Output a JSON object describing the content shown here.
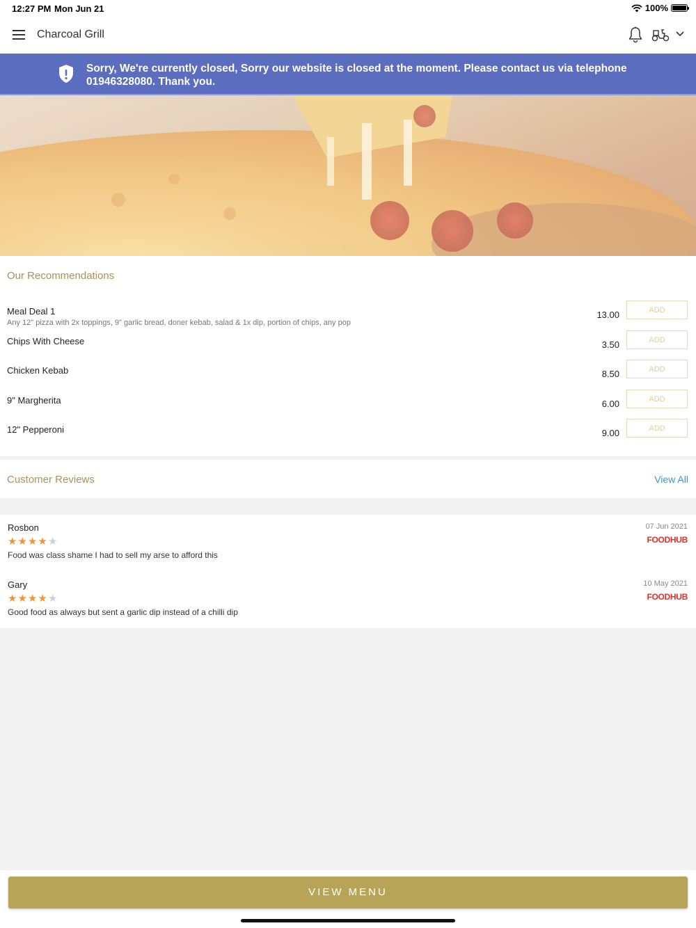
{
  "status_bar": {
    "time": "12:27 PM",
    "date": "Mon Jun 21",
    "battery": "100%"
  },
  "header": {
    "title": "Charcoal Grill"
  },
  "banner": {
    "message": "Sorry, We're currently closed, Sorry our website is closed at the moment. Please contact us via telephone 01946328080. Thank you."
  },
  "recommendations": {
    "title": "Our Recommendations",
    "items": [
      {
        "name": "Meal Deal 1",
        "description": "Any 12\" pizza with 2x toppings, 9\" garlic bread, doner kebab, salad & 1x dip, portion of chips, any pop",
        "price": "13.00",
        "button": "ADD"
      },
      {
        "name": "Chips With Cheese",
        "description": "",
        "price": "3.50",
        "button": "ADD"
      },
      {
        "name": "Chicken Kebab",
        "description": "",
        "price": "8.50",
        "button": "ADD"
      },
      {
        "name": "9\" Margherita",
        "description": "",
        "price": "6.00",
        "button": "ADD"
      },
      {
        "name": "12\" Pepperoni",
        "description": "",
        "price": "9.00",
        "button": "ADD"
      }
    ]
  },
  "reviews_header": {
    "title": "Customer Reviews",
    "view_all": "View All"
  },
  "reviews": [
    {
      "author": "Rosbon",
      "date": "07 Jun 2021",
      "rating": 4,
      "source": "FOODHUB",
      "text": "Food was class shame I had to sell my arse to afford this"
    },
    {
      "author": "Gary",
      "date": "10 May 2021",
      "rating": 4,
      "source": "FOODHUB",
      "text": "Good food as always but sent a garlic dip instead of a chilli dip"
    }
  ],
  "bottom_button": {
    "label": "VIEW MENU"
  },
  "colors": {
    "banner": "#5b6dbf",
    "accent": "#b8a456",
    "section_title": "#a7925a",
    "link": "#3c96c8",
    "star": "#f2953a",
    "brand": "#e0302a"
  }
}
